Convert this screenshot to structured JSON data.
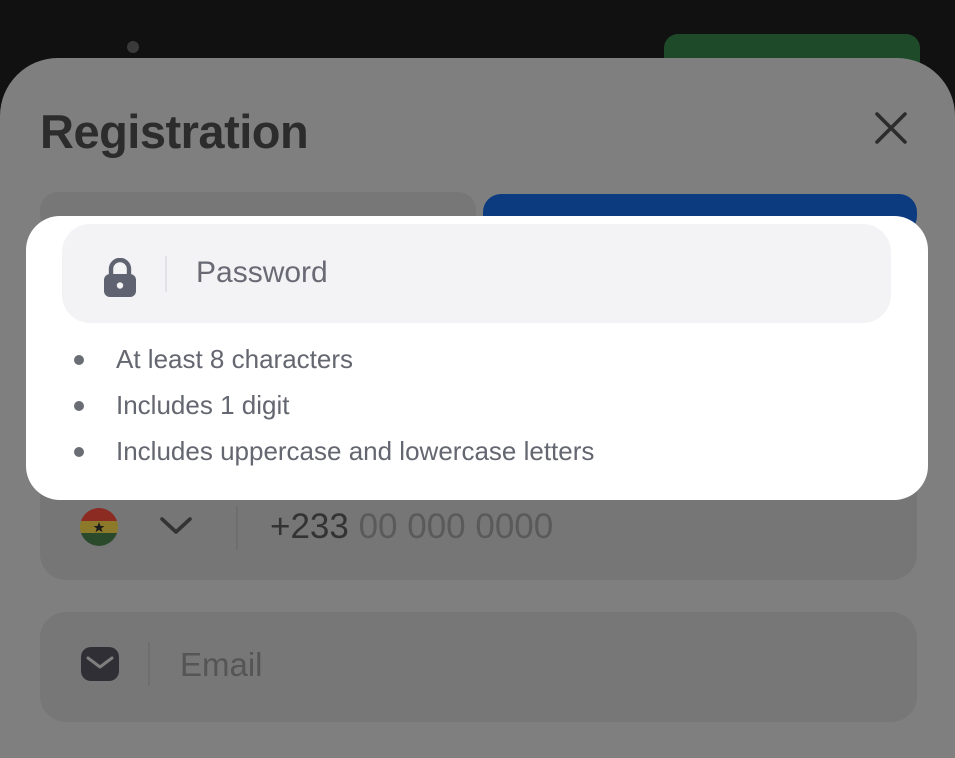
{
  "dialog": {
    "title": "Registration"
  },
  "password": {
    "placeholder": "Password",
    "requirements": [
      "At least 8 characters",
      "Includes 1 digit",
      "Includes uppercase and lowercase letters"
    ]
  },
  "phone": {
    "country_flag": "ghana-flag-icon",
    "prefix": "+233",
    "placeholder": "00 000 0000"
  },
  "email": {
    "placeholder": "Email"
  },
  "icons": {
    "close": "close-icon",
    "lock": "lock-icon",
    "chevron": "chevron-down-icon",
    "mail": "mail-icon"
  },
  "colors": {
    "accent": "#0d3b80",
    "overlay": "#7f7f7f",
    "card": "#ffffff"
  }
}
